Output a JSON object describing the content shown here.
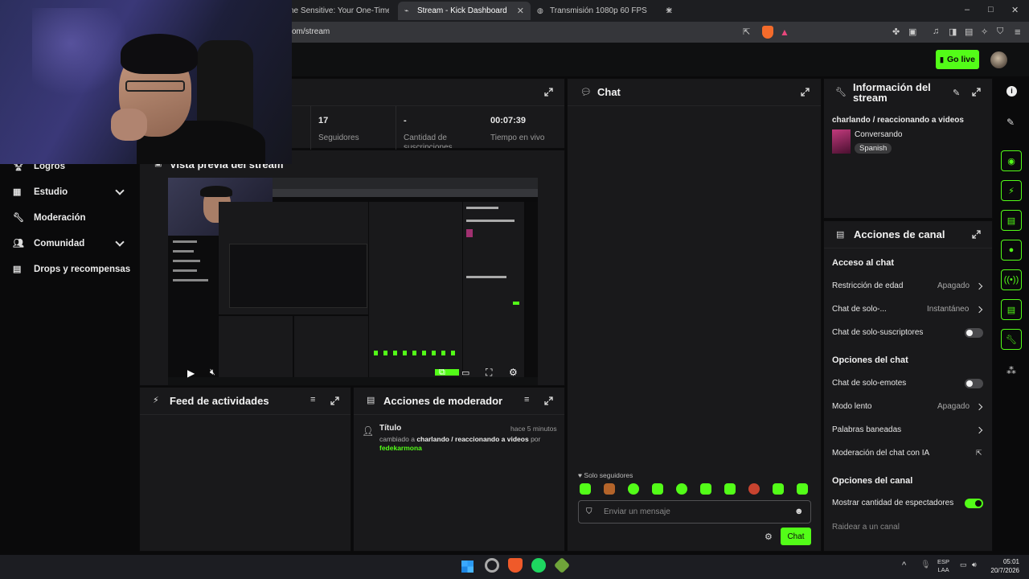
{
  "browser": {
    "tabs": [
      {
        "label": "ne Sensitive: Your One-Time HBO I"
      },
      {
        "label": "Stream - Kick Dashboard"
      },
      {
        "label": "Transmisión 1080p 60 FPS"
      }
    ],
    "new_tab": "+",
    "url": "com/stream",
    "window_controls": {
      "minimize": "–",
      "maximize": "□",
      "close": "✕"
    }
  },
  "header": {
    "go_live_label": "Go live"
  },
  "sidebar": {
    "items": [
      {
        "label": "Logros",
        "icon": "trophy-icon"
      },
      {
        "label": "Estudio",
        "icon": "studio-icon"
      },
      {
        "label": "Moderación",
        "icon": "wrench-icon"
      },
      {
        "label": "Comunidad",
        "icon": "community-icon"
      },
      {
        "label": "Drops y recompensas",
        "icon": "drops-icon"
      }
    ]
  },
  "stats": {
    "items": [
      {
        "value": "17",
        "label": "Seguidores"
      },
      {
        "value": "-",
        "label": "Cantidad de suscripciones"
      },
      {
        "value": "00:07:39",
        "label": "Tiempo en vivo"
      }
    ]
  },
  "preview": {
    "title": "Vista previa del stream"
  },
  "activity_feed": {
    "title": "Feed de actividades"
  },
  "mod_actions": {
    "title": "Acciones de moderador",
    "entry": {
      "title": "Título",
      "time": "hace 5 minutos",
      "text_before": "cambiado a",
      "value": "charlando / reaccionando a videos",
      "text_by": "por",
      "user": "fedekarmona"
    }
  },
  "chat": {
    "title": "Chat",
    "followers_only": "Solo seguidores",
    "placeholder": "Enviar un mensaje",
    "send_label": "Chat"
  },
  "stream_info": {
    "title": "Información del stream",
    "stream_title": "charlando / reaccionando a videos",
    "category": "Conversando",
    "language": "Spanish"
  },
  "channel_actions": {
    "title": "Acciones de canal",
    "chat_access": {
      "heading": "Acceso al chat",
      "age_label": "Restricción de edad",
      "age_value": "Apagado",
      "solo_label": "Chat de solo-...",
      "solo_value": "Instantáneo",
      "subs_label": "Chat de solo-suscriptores"
    },
    "chat_options": {
      "heading": "Opciones del chat",
      "emotes_label": "Chat de solo-emotes",
      "slow_label": "Modo lento",
      "slow_value": "Apagado",
      "banned_label": "Palabras baneadas",
      "ai_label": "Moderación del chat con IA"
    },
    "channel_options": {
      "heading": "Opciones del canal",
      "viewers_label": "Mostrar cantidad de espectadores",
      "raid_label": "Raidear a un canal"
    }
  },
  "taskbar": {
    "tray_up": "^",
    "lang_top": "ESP",
    "lang_bottom": "LAA",
    "time": "05:01",
    "date": "20/7/2026"
  },
  "colors": {
    "accent": "#53fc18",
    "panel": "#19191b",
    "background": "#0a0a0b"
  }
}
